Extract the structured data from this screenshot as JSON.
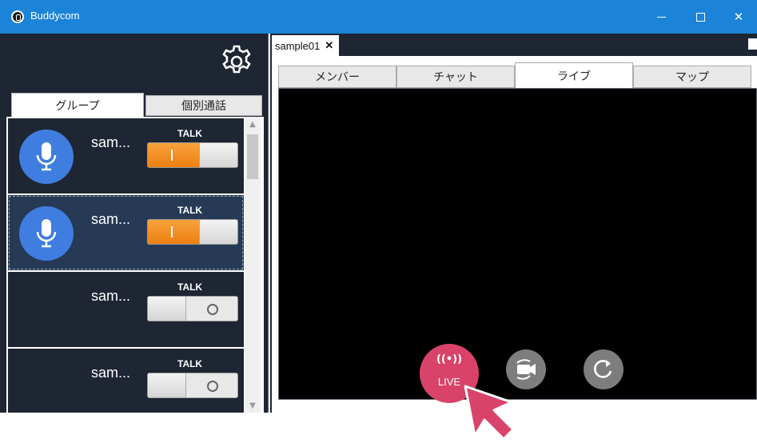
{
  "window": {
    "title": "Buddycom",
    "minimize_glyph": "–",
    "maximize_glyph": "☐",
    "close_glyph": "✕"
  },
  "left_panel": {
    "settings_icon": "gear-icon",
    "tabs": [
      {
        "label": "グループ",
        "active": true
      },
      {
        "label": "個別通話",
        "active": false
      }
    ],
    "members": [
      {
        "name": "sam...",
        "talk_label": "TALK",
        "talk_on": true,
        "has_avatar": true,
        "selected": false
      },
      {
        "name": "sam...",
        "talk_label": "TALK",
        "talk_on": true,
        "has_avatar": true,
        "selected": true
      },
      {
        "name": "sam...",
        "talk_label": "TALK",
        "talk_on": false,
        "has_avatar": false,
        "selected": false
      },
      {
        "name": "sam...",
        "talk_label": "TALK",
        "talk_on": false,
        "has_avatar": false,
        "selected": false
      }
    ]
  },
  "right_panel": {
    "doc_tab": {
      "label": "sample01",
      "close": "✕"
    },
    "tabs": [
      {
        "label": "メンバー",
        "active": false
      },
      {
        "label": "チャット",
        "active": false
      },
      {
        "label": "ライブ",
        "active": true
      },
      {
        "label": "マップ",
        "active": false
      }
    ],
    "live_button": {
      "icon": "((•))",
      "label": "LIVE"
    },
    "camera_switch_icon": "camera-switch-icon",
    "refresh_icon": "refresh-icon"
  },
  "colors": {
    "titlebar": "#1c84d8",
    "panel_bg": "#1e2533",
    "talk_on": "#f08a1c",
    "live": "#d9436a",
    "avatar": "#3f7ee0",
    "cursor": "#d9436a"
  }
}
